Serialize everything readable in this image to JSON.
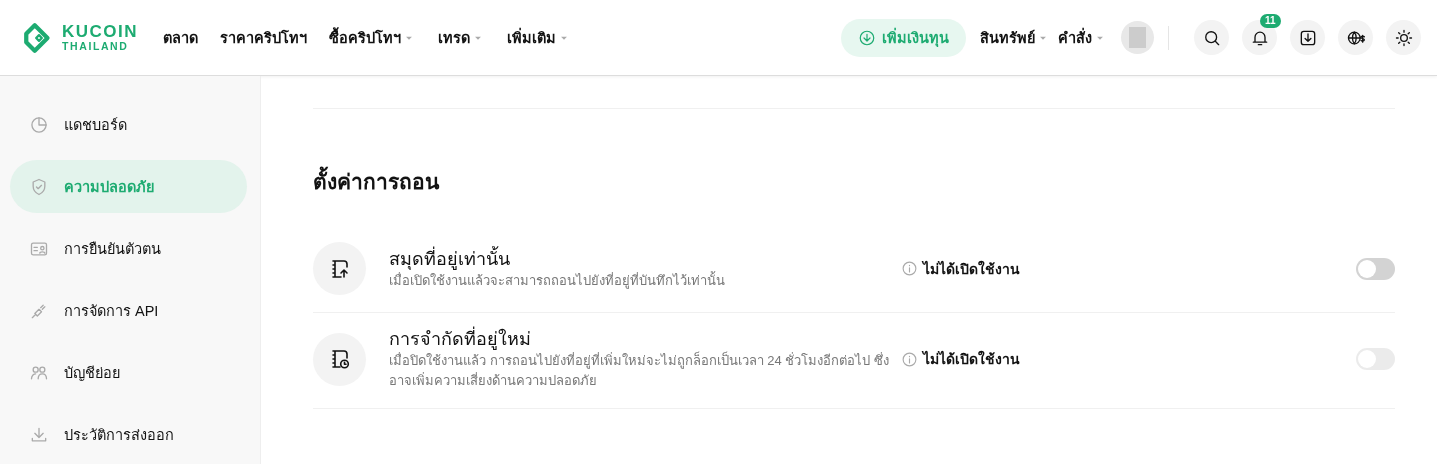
{
  "header": {
    "logo": {
      "name": "KUCOIN",
      "region": "THAILAND"
    },
    "nav": [
      {
        "label": "ตลาด",
        "dropdown": false
      },
      {
        "label": "ราคาคริปโทฯ",
        "dropdown": false
      },
      {
        "label": "ซื้อคริปโทฯ",
        "dropdown": true
      },
      {
        "label": "เทรด",
        "dropdown": true
      },
      {
        "label": "เพิ่มเติม",
        "dropdown": true
      }
    ],
    "deposit_button": "เพิ่มเงินทุน",
    "menus": [
      {
        "label": "สินทรัพย์",
        "dropdown": true
      },
      {
        "label": "คำสั่ง",
        "dropdown": true
      }
    ],
    "notification_count": "11"
  },
  "sidebar": {
    "items": [
      {
        "label": "แดชบอร์ด",
        "selected": false
      },
      {
        "label": "ความปลอดภัย",
        "selected": true
      },
      {
        "label": "การยืนยันตัวตน",
        "selected": false
      },
      {
        "label": "การจัดการ API",
        "selected": false
      },
      {
        "label": "บัญชีย่อย",
        "selected": false
      },
      {
        "label": "ประวัติการส่งออก",
        "selected": false
      }
    ]
  },
  "section": {
    "title": "ตั้งค่าการถอน",
    "settings": [
      {
        "title": "สมุดที่อยู่เท่านั้น",
        "description": "เมื่อเปิดใช้งานแล้วจะสามารถถอนไปยังที่อยู่ที่บันทึกไว้เท่านั้น",
        "status": "ไม่ได้เปิดใช้งาน",
        "on": false,
        "disabled": false
      },
      {
        "title": "การจำกัดที่อยู่ใหม่",
        "description": "เมื่อปิดใช้งานแล้ว การถอนไปยังที่อยู่ที่เพิ่มใหม่จะไม่ถูกล็อกเป็นเวลา 24 ชั่วโมงอีกต่อไป ซึ่งอาจเพิ่มความเสี่ยงด้านความปลอดภัย",
        "status": "ไม่ได้เปิดใช้งาน",
        "on": false,
        "disabled": true
      }
    ]
  }
}
